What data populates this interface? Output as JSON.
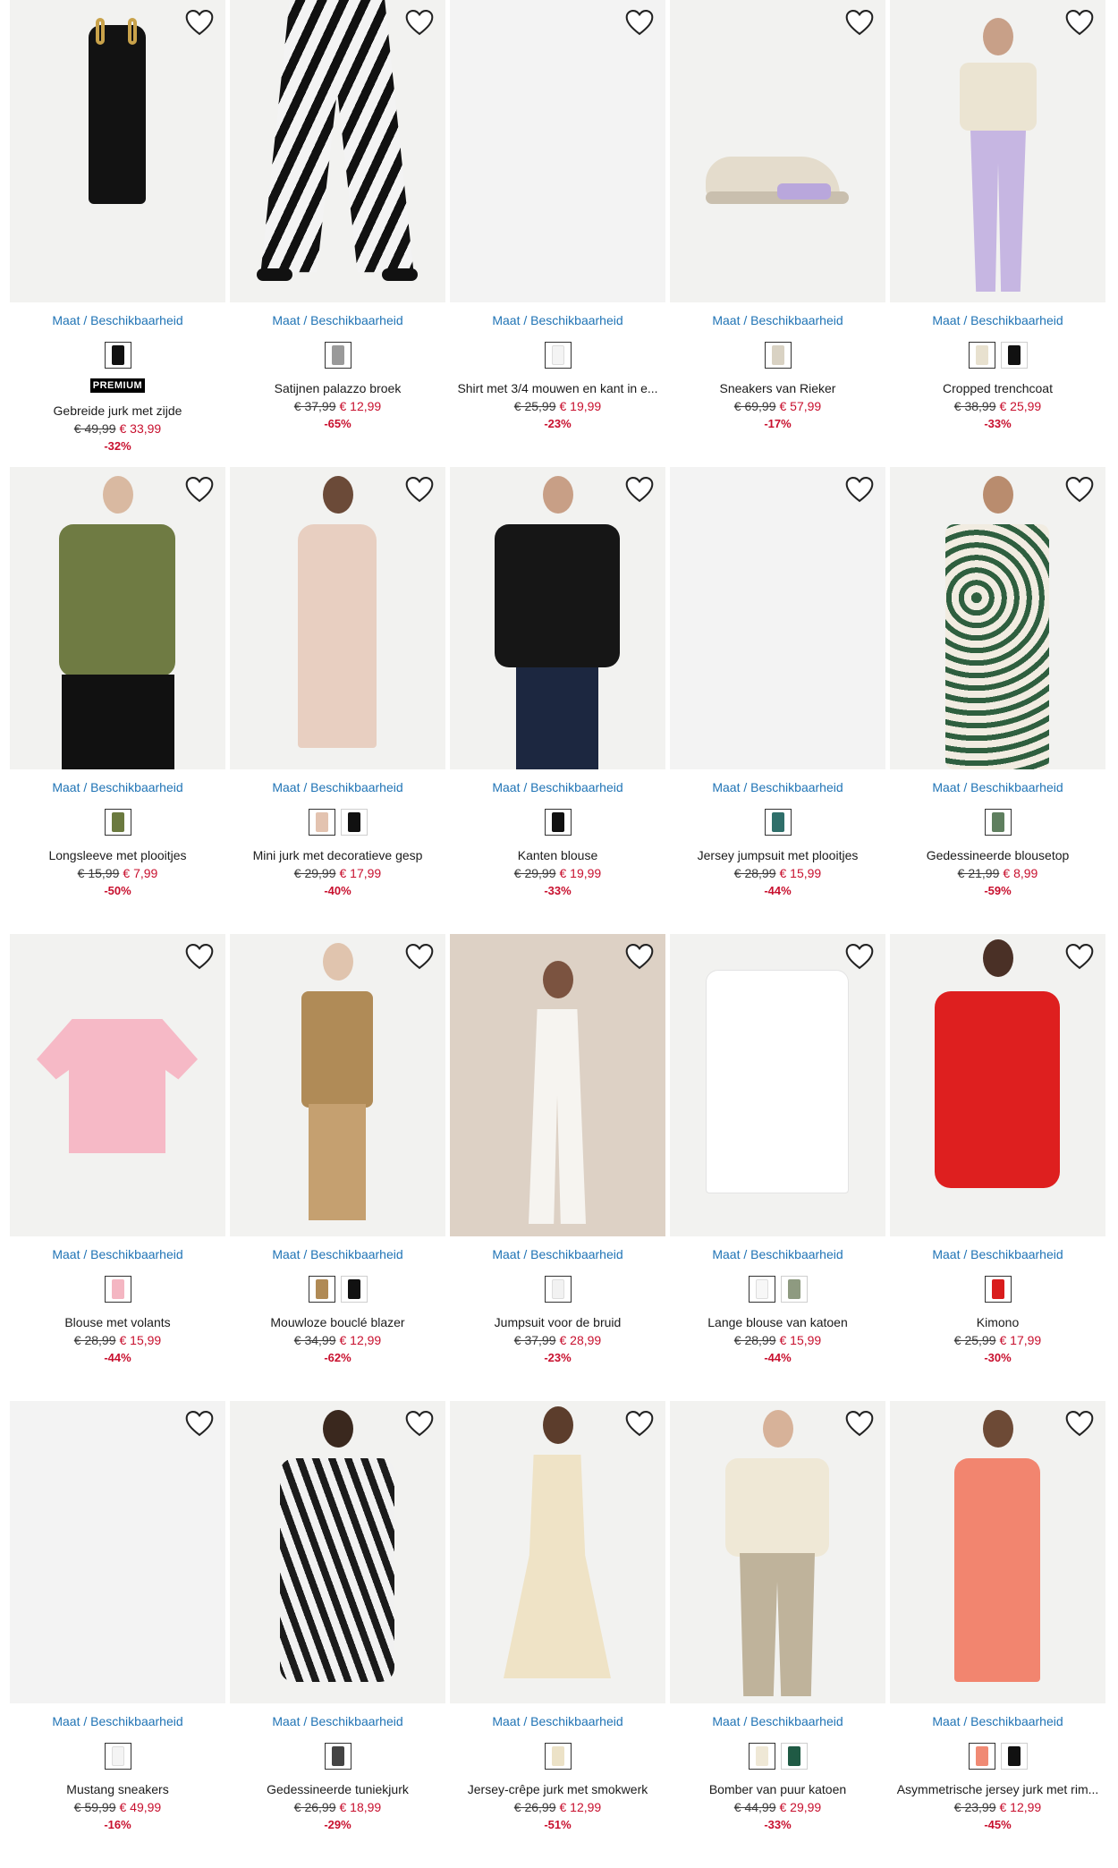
{
  "labels": {
    "availability": "Maat / Beschikbaarheid",
    "premium_badge": "PREMIUM"
  },
  "products": [
    {
      "name": "Gebreide jurk met zijde",
      "old_price": "€ 49,99",
      "new_price": "€ 33,99",
      "discount": "-32%",
      "premium": true,
      "swatches": [
        "#111111"
      ],
      "image": "black-knit-dress"
    },
    {
      "name": "Satijnen palazzo broek",
      "old_price": "€ 37,99",
      "new_price": "€ 12,99",
      "discount": "-65%",
      "premium": false,
      "swatches": [
        "#9a9a9a"
      ],
      "image": "zebra-trousers"
    },
    {
      "name": "Shirt met 3/4 mouwen en kant in e...",
      "old_price": "€ 25,99",
      "new_price": "€ 19,99",
      "discount": "-23%",
      "premium": false,
      "swatches": [
        "#f4f4f4"
      ],
      "image": "empty"
    },
    {
      "name": "Sneakers van Rieker",
      "old_price": "€ 69,99",
      "new_price": "€ 57,99",
      "discount": "-17%",
      "premium": false,
      "swatches": [
        "#d9d2c3"
      ],
      "image": "sneaker-beige-lilac"
    },
    {
      "name": "Cropped trenchcoat",
      "old_price": "€ 38,99",
      "new_price": "€ 25,99",
      "discount": "-33%",
      "premium": false,
      "swatches": [
        "#e8e1cf",
        "#111111"
      ],
      "image": "cropped-trench"
    },
    {
      "name": "Longsleeve met plooitjes",
      "old_price": "€ 15,99",
      "new_price": "€ 7,99",
      "discount": "-50%",
      "premium": false,
      "swatches": [
        "#6b7a3f"
      ],
      "image": "olive-longsleeve"
    },
    {
      "name": "Mini jurk met decoratieve gesp",
      "old_price": "€ 29,99",
      "new_price": "€ 17,99",
      "discount": "-40%",
      "premium": false,
      "swatches": [
        "#e3c3b0",
        "#111111"
      ],
      "image": "champagne-dress"
    },
    {
      "name": "Kanten blouse",
      "old_price": "€ 29,99",
      "new_price": "€ 19,99",
      "discount": "-33%",
      "premium": false,
      "swatches": [
        "#111111"
      ],
      "image": "black-lace-blouse"
    },
    {
      "name": "Jersey jumpsuit met plooitjes",
      "old_price": "€ 28,99",
      "new_price": "€ 15,99",
      "discount": "-44%",
      "premium": false,
      "swatches": [
        "#2f6f6a"
      ],
      "image": "empty"
    },
    {
      "name": "Gedessineerde blousetop",
      "old_price": "€ 21,99",
      "new_price": "€ 8,99",
      "discount": "-59%",
      "premium": false,
      "swatches": [
        "#5f7f5f"
      ],
      "image": "green-print-top"
    },
    {
      "name": "Blouse met volants",
      "old_price": "€ 28,99",
      "new_price": "€ 15,99",
      "discount": "-44%",
      "premium": false,
      "swatches": [
        "#f4b6c2"
      ],
      "image": "pink-ruffle-blouse"
    },
    {
      "name": "Mouwloze bouclé blazer",
      "old_price": "€ 34,99",
      "new_price": "€ 12,99",
      "discount": "-62%",
      "premium": false,
      "swatches": [
        "#b08a55",
        "#111111"
      ],
      "image": "boucle-vest"
    },
    {
      "name": "Jumpsuit voor de bruid",
      "old_price": "€ 37,99",
      "new_price": "€ 28,99",
      "discount": "-23%",
      "premium": false,
      "swatches": [
        "#f2f2f2"
      ],
      "image": "white-jumpsuit"
    },
    {
      "name": "Lange blouse van katoen",
      "old_price": "€ 28,99",
      "new_price": "€ 15,99",
      "discount": "-44%",
      "premium": false,
      "swatches": [
        "#f7f7f7",
        "#8e9a80"
      ],
      "image": "white-long-blouse"
    },
    {
      "name": "Kimono",
      "old_price": "€ 25,99",
      "new_price": "€ 17,99",
      "discount": "-30%",
      "premium": false,
      "swatches": [
        "#d91c1c"
      ],
      "image": "red-kimono"
    },
    {
      "name": "Mustang sneakers",
      "old_price": "€ 59,99",
      "new_price": "€ 49,99",
      "discount": "-16%",
      "premium": false,
      "swatches": [
        "#f4f4f4"
      ],
      "image": "empty"
    },
    {
      "name": "Gedessineerde tuniekjurk",
      "old_price": "€ 26,99",
      "new_price": "€ 18,99",
      "discount": "-29%",
      "premium": false,
      "swatches": [
        "#444444"
      ],
      "image": "zebra-tunic"
    },
    {
      "name": "Jersey-crêpe jurk met smokwerk",
      "old_price": "€ 26,99",
      "new_price": "€ 12,99",
      "discount": "-51%",
      "premium": false,
      "swatches": [
        "#ece2c7"
      ],
      "image": "cream-dress"
    },
    {
      "name": "Bomber van puur katoen",
      "old_price": "€ 44,99",
      "new_price": "€ 29,99",
      "discount": "-33%",
      "premium": false,
      "swatches": [
        "#efe8d6",
        "#1f5a44"
      ],
      "image": "cream-bomber"
    },
    {
      "name": "Asymmetrische jersey jurk met rim...",
      "old_price": "€ 23,99",
      "new_price": "€ 12,99",
      "discount": "-45%",
      "premium": false,
      "swatches": [
        "#f08a74",
        "#111111"
      ],
      "image": "coral-dress"
    }
  ]
}
